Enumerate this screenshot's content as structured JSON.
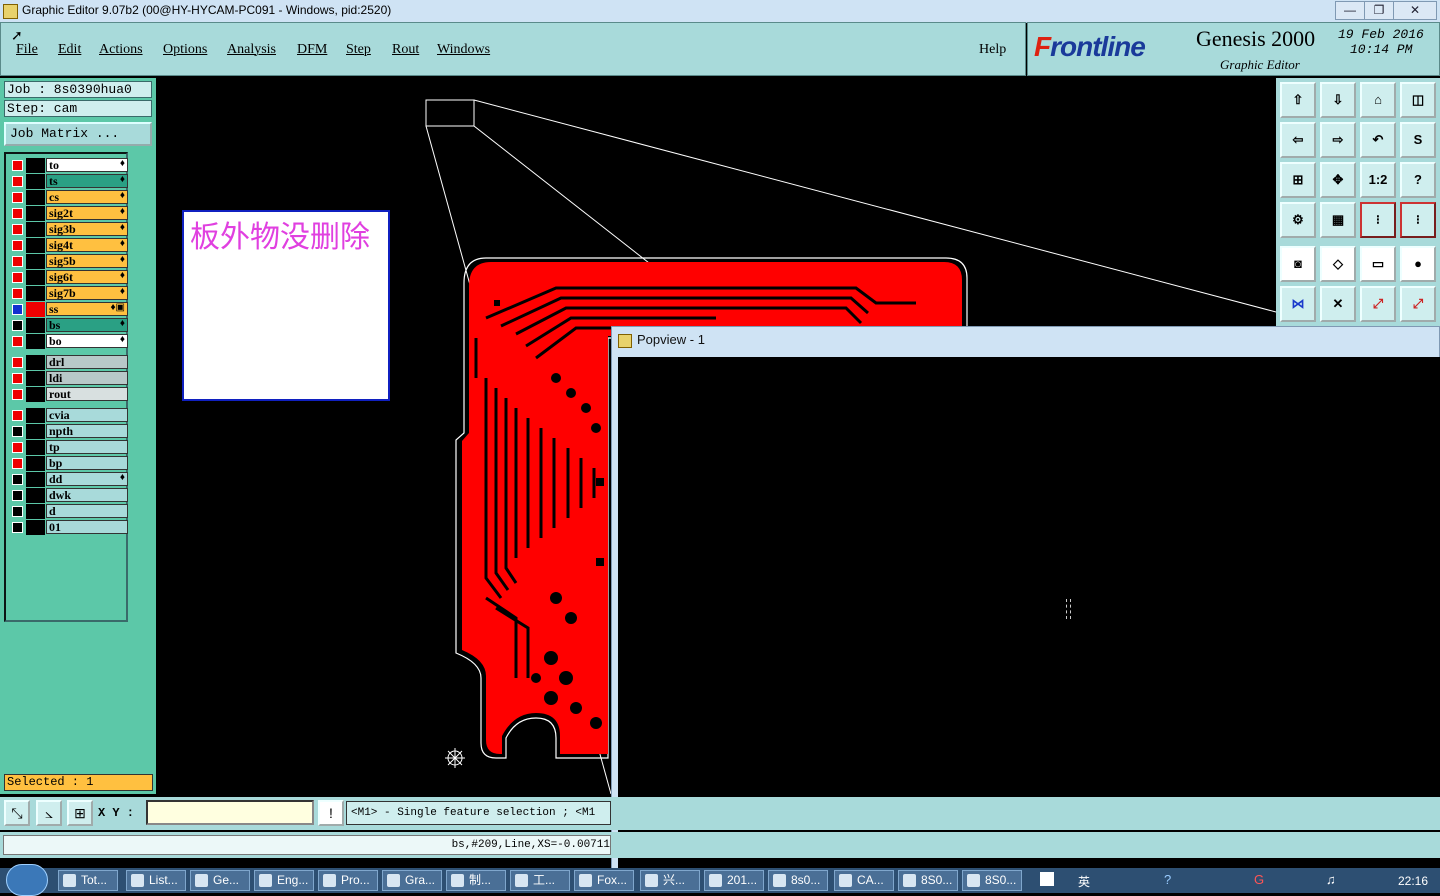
{
  "window": {
    "title": "Graphic Editor 9.07b2 (00@HY-HYCAM-PC091 - Windows, pid:2520)",
    "min": "—",
    "max": "❐",
    "close": "✕"
  },
  "menu": {
    "file": "File",
    "edit": "Edit",
    "actions": "Actions",
    "options": "Options",
    "analysis": "Analysis",
    "dfm": "DFM",
    "step": "Step",
    "rout": "Rout",
    "windows": "Windows",
    "help": "Help"
  },
  "brand": {
    "logo_accent": "F",
    "logo_rest": "rontline",
    "product": "Genesis 2000",
    "subtitle": "Graphic Editor",
    "date": "19 Feb 2016",
    "time": "10:14 PM"
  },
  "job": {
    "job_label": "Job : 8s0390hua0",
    "step_label": "Step: cam",
    "matrix_button": "Job Matrix ..."
  },
  "layers": [
    {
      "name": "to",
      "color": "#ffffff",
      "check": "red",
      "sq": "black",
      "icon": "♦"
    },
    {
      "name": "ts",
      "color": "#2aa084",
      "check": "red",
      "sq": "black",
      "icon": "♦"
    },
    {
      "name": "cs",
      "color": "#ffc040",
      "check": "red",
      "sq": "black",
      "icon": "♦"
    },
    {
      "name": "sig2t",
      "color": "#ffc040",
      "check": "red",
      "sq": "black",
      "icon": "♦"
    },
    {
      "name": "sig3b",
      "color": "#ffc040",
      "check": "red",
      "sq": "black",
      "icon": "♦"
    },
    {
      "name": "sig4t",
      "color": "#ffc040",
      "check": "red",
      "sq": "black",
      "icon": "♦"
    },
    {
      "name": "sig5b",
      "color": "#ffc040",
      "check": "red",
      "sq": "black",
      "icon": "♦"
    },
    {
      "name": "sig6t",
      "color": "#ffc040",
      "check": "red",
      "sq": "black",
      "icon": "♦"
    },
    {
      "name": "sig7b",
      "color": "#ffc040",
      "check": "red",
      "sq": "black",
      "icon": "♦"
    },
    {
      "name": "ss",
      "color": "#ffc040",
      "check": "blue",
      "sq": "red",
      "icon": "♦▣"
    },
    {
      "name": "bs",
      "color": "#2aa084",
      "check": "off",
      "sq": "black",
      "icon": "♦"
    },
    {
      "name": "bo",
      "color": "#ffffff",
      "check": "red",
      "sq": "black",
      "icon": "♦"
    },
    {
      "name": "drl",
      "color": "#b8c8c8",
      "check": "red",
      "sq": "black",
      "icon": ""
    },
    {
      "name": "ldi",
      "color": "#b8c8c8",
      "check": "red",
      "sq": "black",
      "icon": ""
    },
    {
      "name": "rout",
      "color": "#d8e0e0",
      "check": "red",
      "sq": "black",
      "icon": ""
    },
    {
      "name": "cvia",
      "color": "#a8dada",
      "check": "red",
      "sq": "black",
      "icon": ""
    },
    {
      "name": "npth",
      "color": "#a8dada",
      "check": "off",
      "sq": "black",
      "icon": ""
    },
    {
      "name": "tp",
      "color": "#a8dada",
      "check": "red",
      "sq": "black",
      "icon": ""
    },
    {
      "name": "bp",
      "color": "#a8dada",
      "check": "red",
      "sq": "black",
      "icon": ""
    },
    {
      "name": "dd",
      "color": "#a8dada",
      "check": "off",
      "sq": "black",
      "icon": "♦"
    },
    {
      "name": "dwk",
      "color": "#a8dada",
      "check": "off",
      "sq": "black",
      "icon": ""
    },
    {
      "name": "d",
      "color": "#a8dada",
      "check": "off",
      "sq": "black",
      "icon": ""
    },
    {
      "name": "01",
      "color": "#a8dada",
      "check": "off",
      "sq": "black",
      "icon": ""
    }
  ],
  "selected": "Selected : 1",
  "note": "板外物没删除",
  "popview": {
    "title": "Popview - 1"
  },
  "cmd": {
    "xy_label": "X Y :",
    "xy_value": "",
    "hint": "<M1> - Single feature selection ; <M1",
    "status": "bs,#209,Line,XS=-0.00711"
  },
  "taskbar": {
    "items": [
      "Tot...",
      "List...",
      "Ge...",
      "Eng...",
      "Pro...",
      "Gra...",
      "制...",
      "工...",
      "Fox...",
      "兴...",
      "201...",
      "8s0...",
      "CA...",
      "8S0...",
      "8S0..."
    ],
    "tray_lang": "英",
    "clock": "22:16"
  },
  "colors": {
    "board": "#ff0000",
    "menu_bg": "#a8dada",
    "panel_bg": "#5cc8a8",
    "note_text": "#e040e0"
  }
}
